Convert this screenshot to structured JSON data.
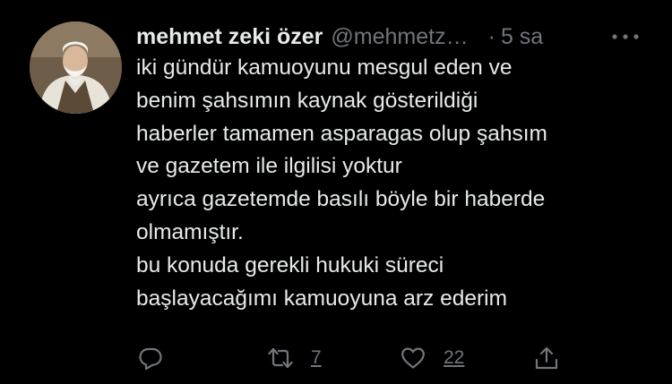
{
  "tweet": {
    "author_name": "mehmet zeki özer",
    "handle": "@mehmetz…",
    "separator": "·",
    "time": "5 sa",
    "lines": [
      "iki gündür kamuoyunu mesgul eden ve",
      "benim şahsımın kaynak gösterildiği",
      "haberler tamamen asparagas olup şahsım",
      "ve gazetem ile ilgilisi yoktur",
      "ayrıca gazetemde basılı böyle bir haberde",
      "olmamıştır.",
      "bu konuda gerekli hukuki süreci",
      "başlayacağımı kamuoyuna arz ederim"
    ]
  },
  "actions": {
    "reply": {
      "icon": "reply-icon"
    },
    "retweet": {
      "icon": "retweet-icon",
      "count": "7"
    },
    "like": {
      "icon": "heart-icon",
      "count": "22"
    },
    "share": {
      "icon": "share-icon"
    }
  },
  "theme": {
    "background": "#000000",
    "text": "#e7e9ea",
    "muted": "#71767b"
  }
}
